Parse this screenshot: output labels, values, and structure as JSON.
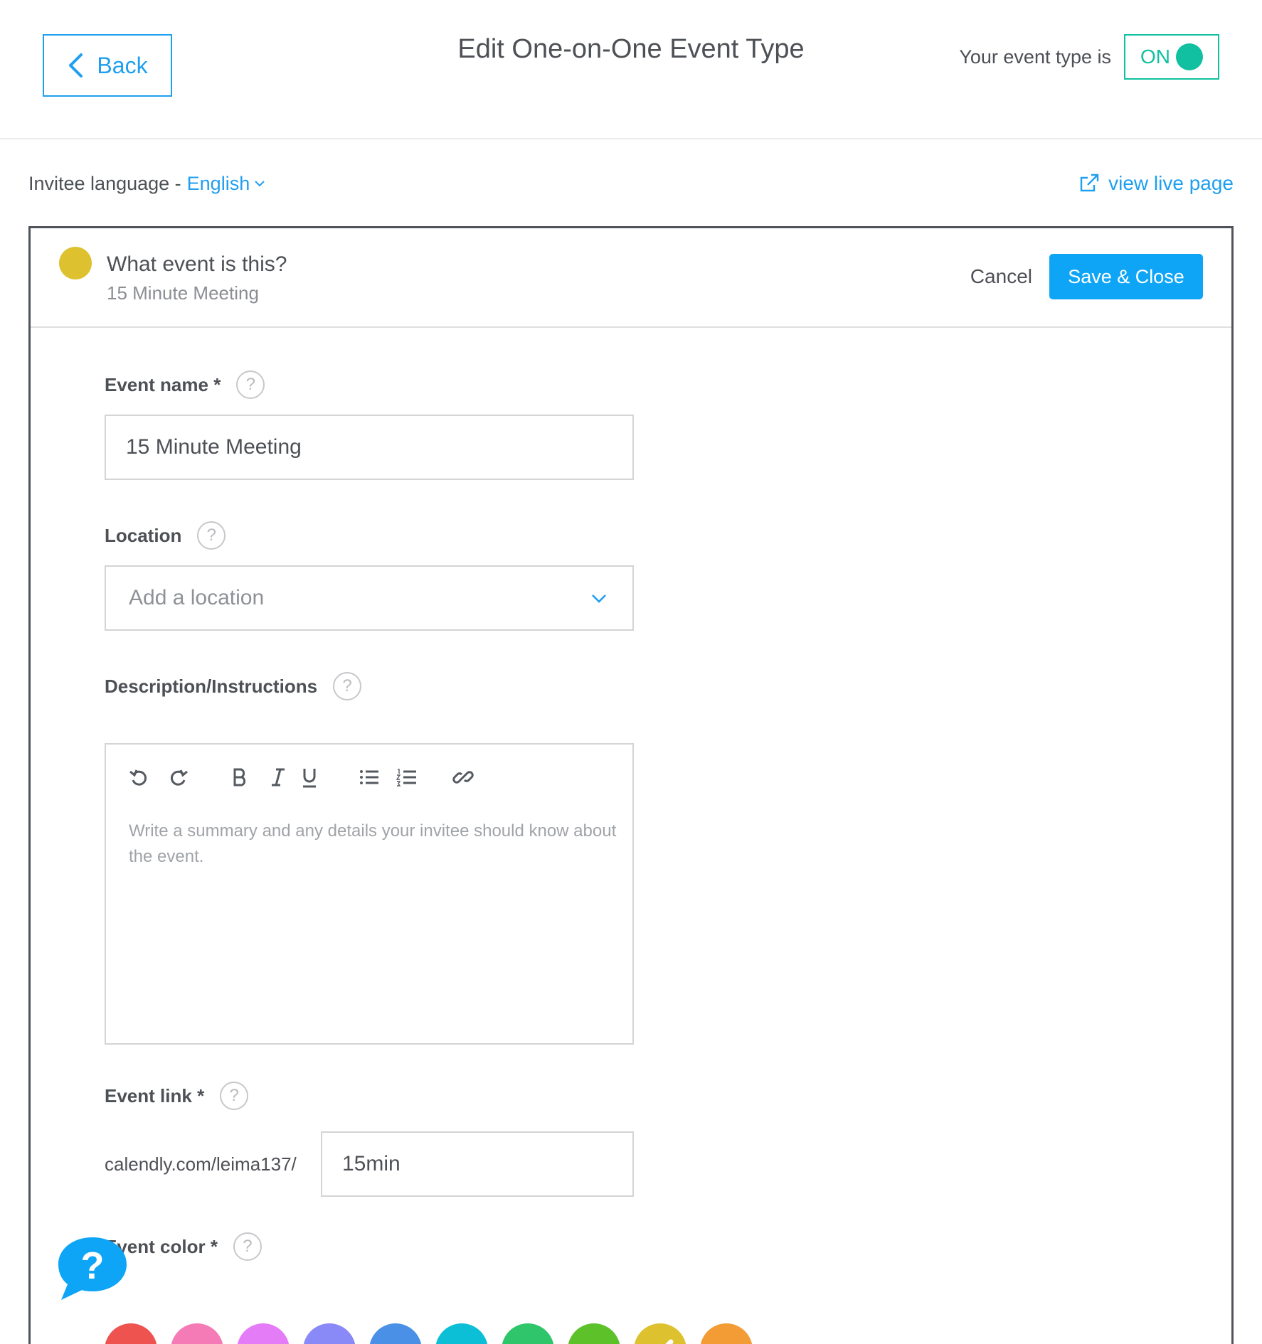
{
  "header": {
    "back_label": "Back",
    "title": "Edit One-on-One Event Type",
    "status_label": "Your event type is",
    "toggle_label": "ON"
  },
  "subbar": {
    "language_label": "Invitee language -",
    "language_value": "English",
    "live_link": "view live page"
  },
  "card": {
    "title": "What event is this?",
    "subtitle": "15 Minute Meeting",
    "dot_color": "#dec12e",
    "cancel_label": "Cancel",
    "save_label": "Save & Close"
  },
  "fields": {
    "event_name": {
      "label": "Event name",
      "required": "*",
      "value": "15 Minute Meeting"
    },
    "location": {
      "label": "Location",
      "placeholder": "Add a location"
    },
    "description": {
      "label": "Description/Instructions",
      "placeholder": "Write a summary and any details your invitee should know about the event.",
      "toolbar": [
        "undo-icon",
        "redo-icon",
        "bold-icon",
        "italic-icon",
        "underline-icon",
        "bullet-list-icon",
        "numbered-list-icon",
        "link-icon"
      ]
    },
    "event_link": {
      "label": "Event link",
      "required": "*",
      "prefix": "calendly.com/leima137/",
      "value": "15min"
    },
    "event_color": {
      "label": "Event color",
      "required": "*",
      "options": [
        "#ee5350",
        "#f57bb7",
        "#e57cf7",
        "#8a89f8",
        "#4a90e6",
        "#0cbfd6",
        "#2fc56a",
        "#5dc22a",
        "#dec12e",
        "#f39c36"
      ],
      "selected_index": 8
    }
  },
  "help_symbol": "?",
  "colors": {
    "accent": "#1f9ff0",
    "toggle_on": "#10c0a0",
    "save": "#0ea5f7"
  }
}
